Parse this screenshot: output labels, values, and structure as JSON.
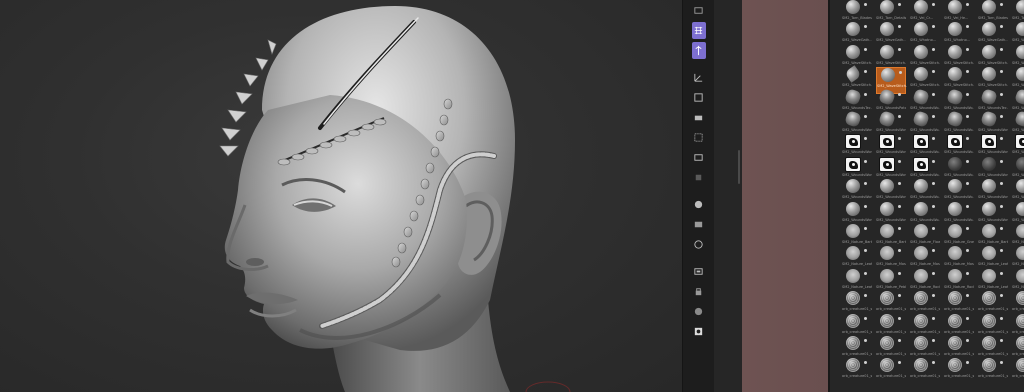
{
  "viewport": {
    "model": "sculpted-head"
  },
  "right_shelf": {
    "buttons": [
      {
        "icon": "persp-icon",
        "active": false
      },
      {
        "icon": "floor-grid-icon",
        "active": true
      },
      {
        "icon": "local-symmetry-icon",
        "active": true
      },
      {
        "icon": "xyz-axis-icon",
        "active": false
      },
      {
        "icon": "frame-icon",
        "active": false
      },
      {
        "icon": "move-icon",
        "active": false
      },
      {
        "icon": "zoom-icon",
        "active": false
      },
      {
        "icon": "rotate-icon",
        "active": false
      },
      {
        "icon": "polyframe-icon",
        "active": false
      },
      {
        "icon": "transparency-icon",
        "active": false
      },
      {
        "icon": "ghost-icon",
        "active": false
      },
      {
        "icon": "solo-icon",
        "active": false
      },
      {
        "icon": "xpose-icon",
        "active": false
      },
      {
        "icon": "lock-icon",
        "active": false
      },
      {
        "icon": "dot-icon",
        "active": false
      },
      {
        "icon": "record-icon",
        "active": false
      }
    ]
  },
  "brush_palette": {
    "rows": [
      [
        "SM2_Torn_Blades01",
        "SM2_Torn_Details01",
        "SM2_Vei_Cr...",
        "SM2_Vei_He..."
      ],
      [
        "SM2_WaveGath...",
        "SM2_WaveGath...",
        "SM2_Whatno...",
        "SM2_Whatno..."
      ],
      [
        "SM2_WaveStitch...",
        "SM2_WaveStitch...",
        "SM2_WaveStitch...",
        "SM2_WaveStitch..."
      ],
      [
        "SM2_WaveStitch...",
        "SM2_WaveStitch...",
        "SM2_WaveStitch...",
        "SM2_WaveStitch..."
      ],
      [
        "SM2_WoundsTec...",
        "SM2_WoundsPatch...",
        "SM2_WoundsWo...",
        "SM2_WoundsWo..."
      ],
      [
        "SM2_WoundsWor...",
        "SM2_WoundsWor...",
        "SM2_WoundsWo...",
        "SM2_WoundsWo..."
      ],
      [
        "SM2_WoundsWor...",
        "SM2_WoundsWor...",
        "SM2_WoundsWo...",
        "SM2_WoundsWo..."
      ],
      [
        "SM2_WoundsWor...",
        "SM2_WoundsWor...",
        "SM2_WoundsWo...",
        "SM2_WoundsWo..."
      ],
      [
        "SM2_WoundsWor...",
        "SM2_WoundsWor...",
        "SM2_WoundsWo...",
        "SM2_WoundsWo..."
      ],
      [
        "SM2_WoundsWor...",
        "SM2_WoundsWor...",
        "SM2_WoundsWo...",
        "SM2_WoundsWo..."
      ],
      [
        "SM2_Nature_Bark01",
        "SM2_Nature_Bark02",
        "SM2_Nature_Flowe...",
        "SM2_Nature_Grass..."
      ],
      [
        "SM2_Nature_Leaf01",
        "SM2_Nature_Moss...",
        "SM2_Nature_Moss...",
        "SM2_Nature_Moss..."
      ],
      [
        "SM2_Nature_Leaf02",
        "SM2_Nature_Pebb...",
        "SM2_Nature_Rock...",
        "SM2_Nature_Rock..."
      ],
      [
        "orb_creature01_sk...",
        "orb_creature01_sk...",
        "orb_creature01_sk...",
        "orb_creature01_sk..."
      ],
      [
        "orb_creature01_sk...",
        "orb_creature01_sk...",
        "orb_creature01_sk...",
        "orb_creature01_sk..."
      ],
      [
        "orb_creature01_sk...",
        "orb_creature01_sk...",
        "orb_creature01_sk...",
        "orb_creature01_sk..."
      ],
      [
        "orb_creature01_sk...",
        "orb_creature01_sk...",
        "orb_creature01_sk...",
        "orb_creature01_sk..."
      ]
    ],
    "selected": "SM2_WaveStitch..."
  }
}
